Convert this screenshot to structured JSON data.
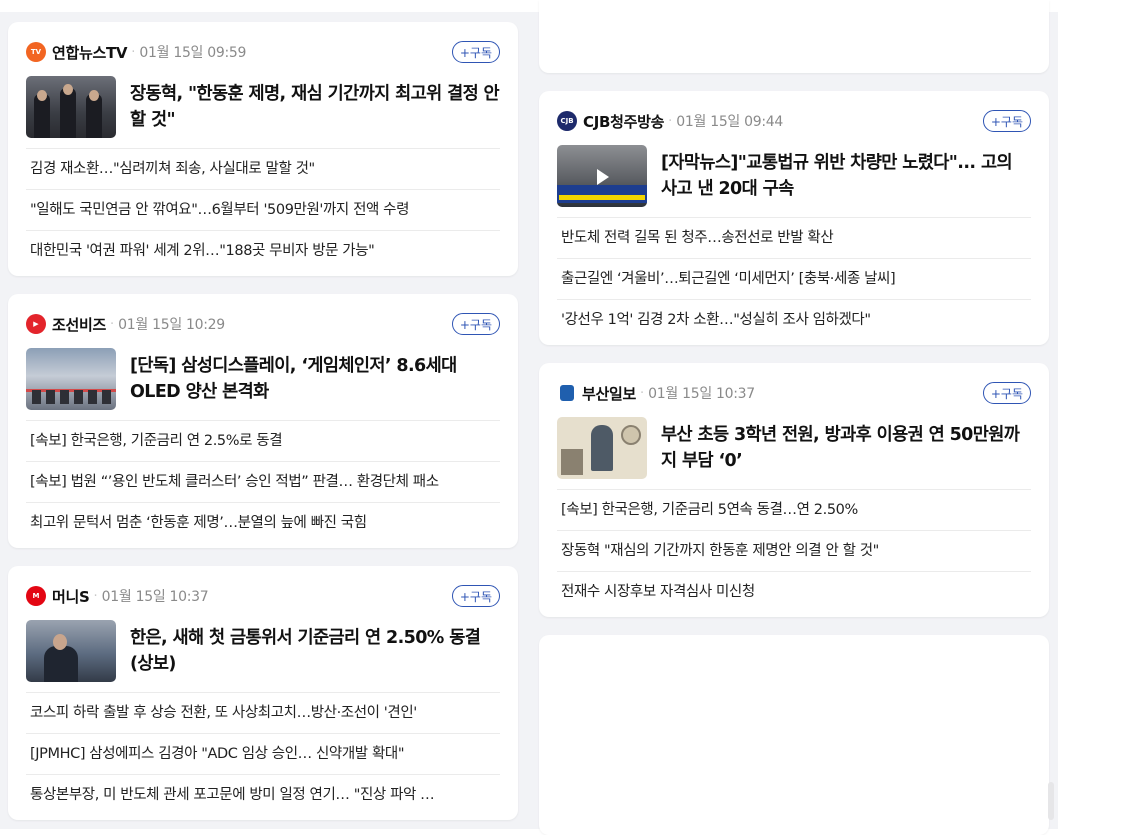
{
  "subscribe_label": "+구독",
  "cards": [
    {
      "press": "연합뉴스TV",
      "logo_color": "#f26522",
      "time": "01월 15일 09:59",
      "title": "장동혁, \"한동훈 제명, 재심 기간까지 최고위 결정 안 할 것\"",
      "items": [
        "김경 재소환…\"심려끼쳐 죄송, 사실대로 말할 것\"",
        "\"일해도 국민연금 안 깎여요\"…6월부터 '509만원'까지 전액 수령",
        "대한민국 '여권 파워' 세계 2위…\"188곳 무비자 방문 가능\""
      ]
    },
    {
      "press": "조선비즈",
      "logo_color": "#e3242b",
      "time": "01월 15일 10:29",
      "title": "[단독] 삼성디스플레이, ‘게임체인저’ 8.6세대 OLED 양산 본격화",
      "items": [
        "[속보] 한국은행, 기준금리 연 2.5%로 동결",
        "[속보] 법원 “’용인 반도체 클러스터’ 승인 적법” 판결… 환경단체 패소",
        "최고위 문턱서 멈춘 ‘한동훈 제명’…분열의 늪에 빠진 국힘"
      ]
    },
    {
      "press": "머니S",
      "logo_color": "#e30613",
      "time": "01월 15일 10:37",
      "title": "한은, 새해 첫 금통위서 기준금리 연 2.50% 동결 (상보)",
      "items": [
        "코스피 하락 출발 후 상승 전환, 또 사상최고치…방산·조선이 '견인'",
        "[JPMHC] 삼성에피스 김경아 \"ADC 임상 승인… 신약개발 확대\"",
        "통상본부장, 미 반도체 관세 포고문에 방미 일정 연기… \"진상 파악 …"
      ]
    },
    {
      "press": "CJB청주방송",
      "logo_color": "#1d2a6b",
      "time": "01월 15일 09:44",
      "title": "[자막뉴스]\"교통법규 위반 차량만 노렸다\"... 고의 사고 낸 20대 구속",
      "items": [
        "반도체 전력 길목 된 청주…송전선로 반발 확산",
        "출근길엔 ‘겨울비’…퇴근길엔 ‘미세먼지’ [충북·세종 날씨]",
        "'강선우 1억' 김경 2차 소환…\"성실히 조사 임하겠다\""
      ]
    },
    {
      "press": "부산일보",
      "logo_color": "#1f5fae",
      "time": "01월 15일 10:37",
      "title": "부산 초등 3학년 전원, 방과후 이용권 연 50만원까지 부담 ‘0’",
      "items": [
        "[속보] 한국은행, 기준금리 5연속 동결…연 2.50%",
        "장동혁 \"재심의 기간까지 한동훈 제명안 의결 안 할 것\"",
        "전재수 시장후보 자격심사 미신청"
      ]
    }
  ]
}
